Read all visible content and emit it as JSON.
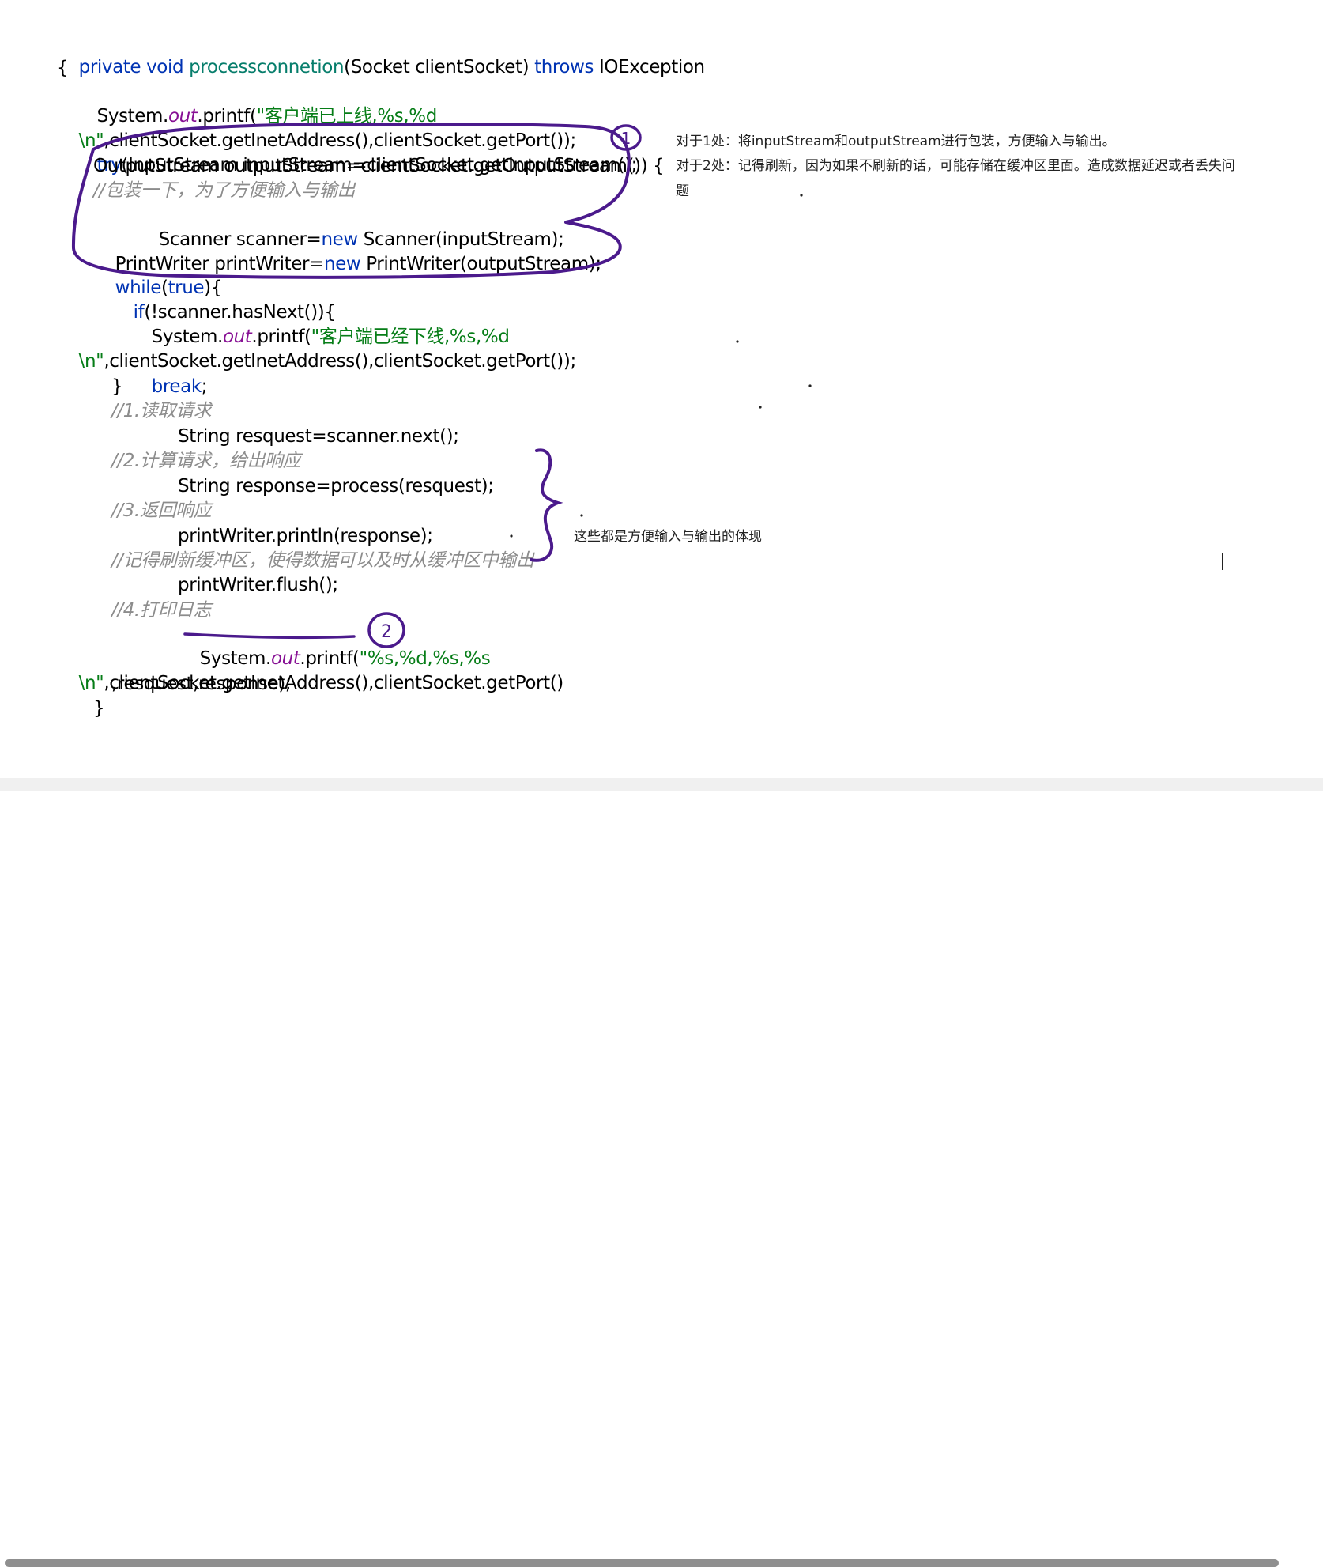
{
  "code": {
    "line_signature": {
      "kw_private_void": "private void ",
      "method_name": "processconnetion",
      "params": "(Socket clientSocket) ",
      "kw_throws": "throws",
      "exception": " IOException"
    },
    "line_open_brace": "{",
    "line_printf_online": {
      "pre": "System.",
      "field": "out",
      "call": ".printf(",
      "str": "\"客户端已上线,%s,%d"
    },
    "line_online_cont": {
      "str": "\\n\"",
      "rest": ",clientSocket.getInetAddress(),clientSocket.getPort());"
    },
    "line_try": {
      "kw": "try",
      "rest": "(InputStream inputStream=clientSocket.getInputStream();"
    },
    "line_output_stream": "OutputStream outputStream=clientSocket.getOutputStream()) {",
    "line_comment_wrap": "//包装一下，为了方便输入与输出",
    "line_scanner": {
      "pre": "Scanner scanner=",
      "kw": "new",
      "rest": " Scanner(inputStream);"
    },
    "line_printwriter": {
      "pre": "PrintWriter printWriter=",
      "kw": "new",
      "rest": " PrintWriter(outputStream);"
    },
    "line_while": {
      "kw_while": "while",
      "paren_open": "(",
      "kw_true": "true",
      "rest": "){"
    },
    "line_if": {
      "kw": "if",
      "rest": "(!scanner.hasNext()){"
    },
    "line_printf_offline": {
      "pre": "System.",
      "field": "out",
      "call": ".printf(",
      "str": "\"客户端已经下线,%s,%d"
    },
    "line_offline_cont": {
      "str": "\\n\"",
      "rest": ",clientSocket.getInetAddress(),clientSocket.getPort());"
    },
    "line_break": {
      "kw": "break",
      "rest": ";"
    },
    "line_close_if": "}",
    "line_comment_1": "//1.读取请求",
    "line_request": "String resquest=scanner.next();",
    "line_comment_2": "//2.计算请求，给出响应",
    "line_response": "String response=process(resquest);",
    "line_comment_3": "//3.返回响应",
    "line_println": "printWriter.println(response);",
    "line_comment_flush": "//记得刷新缓冲区，使得数据可以及时从缓冲区中输出",
    "line_flush": "printWriter.flush();",
    "line_comment_4": "//4.打印日志",
    "line_printf_log": {
      "pre": "System.",
      "field": "out",
      "call": ".printf(",
      "str": "\"%s,%d,%s,%s"
    },
    "line_log_cont": {
      "str": "\\n\"",
      "rest": ",clientSocket.getInetAddress(),clientSocket.getPort()"
    },
    "line_log_args": ",resquest,response);",
    "line_close_while": "}"
  },
  "notes": {
    "note_1": "对于1处：将inputStream和outputStream进行包装，方便输入与输出。",
    "note_2_line1": "对于2处：记得刷新，因为如果不刷新的话，可能存储在缓冲区里面。造成数据延迟或者丢失问",
    "note_2_line2": "题",
    "brace_note": "这些都是方便输入与输出的体现"
  },
  "markers": {
    "label_1": "1",
    "label_2": "2"
  },
  "colors": {
    "keyword": "#0033b3",
    "method": "#067d6b",
    "static_field": "#871094",
    "string": "#067d17",
    "comment": "#8c8c8c",
    "ink": "#4b1a8c"
  }
}
